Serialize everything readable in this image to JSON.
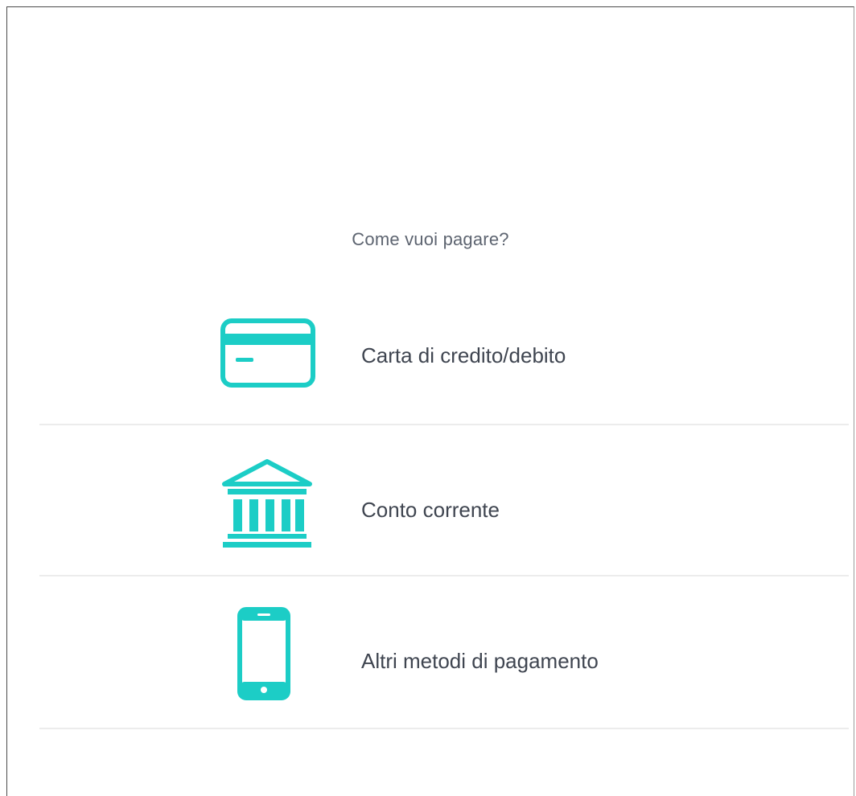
{
  "page": {
    "question": "Come vuoi pagare?"
  },
  "methods": [
    {
      "label": "Carta di credito/debito",
      "icon": "credit-card-icon"
    },
    {
      "label": "Conto corrente",
      "icon": "bank-icon"
    },
    {
      "label": "Altri metodi di pagamento",
      "icon": "smartphone-icon"
    }
  ],
  "colors": {
    "accent": "#1ccdc6",
    "text": "#3f4550",
    "muted": "#5d6470",
    "divider": "#ececec"
  }
}
